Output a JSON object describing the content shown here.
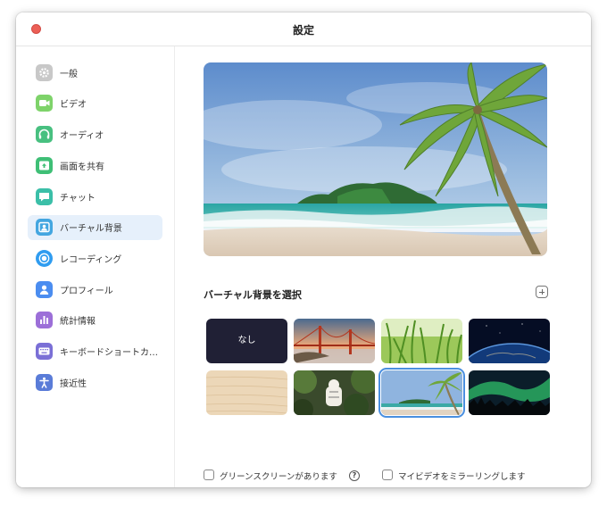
{
  "window": {
    "title": "設定"
  },
  "sidebar": {
    "items": [
      {
        "label": "一般",
        "icon": "gear-icon",
        "color": "#c8c8c8"
      },
      {
        "label": "ビデオ",
        "icon": "video-camera-icon",
        "color": "#7ed36a"
      },
      {
        "label": "オーディオ",
        "icon": "headphones-icon",
        "color": "#48c080"
      },
      {
        "label": "画面を共有",
        "icon": "share-screen-icon",
        "color": "#3fbf76"
      },
      {
        "label": "チャット",
        "icon": "chat-bubble-icon",
        "color": "#3bbfa8"
      },
      {
        "label": "バーチャル背景",
        "icon": "virtual-background-icon",
        "color": "#43a6e0"
      },
      {
        "label": "レコーディング",
        "icon": "record-icon",
        "color": "#2f9cf0"
      },
      {
        "label": "プロフィール",
        "icon": "person-icon",
        "color": "#4b8df0"
      },
      {
        "label": "統計情報",
        "icon": "bar-chart-icon",
        "color": "#9c6fd8"
      },
      {
        "label": "キーボードショートカ…",
        "icon": "keyboard-icon",
        "color": "#7a6fd6"
      },
      {
        "label": "接近性",
        "icon": "accessibility-icon",
        "color": "#5a7cd8"
      }
    ],
    "active_index": 5
  },
  "main": {
    "section_title": "バーチャル背景を選択",
    "thumbnails": [
      {
        "label": "なし",
        "kind": "none"
      },
      {
        "kind": "golden-gate-bridge"
      },
      {
        "kind": "grass"
      },
      {
        "kind": "earth-from-space"
      },
      {
        "kind": "wood"
      },
      {
        "kind": "white-tiger-jungle"
      },
      {
        "kind": "beach-palm",
        "selected": true
      },
      {
        "kind": "aurora"
      }
    ],
    "green_screen_label": "グリーンスクリーンがあります",
    "mirror_label": "マイビデオをミラーリングします",
    "help_glyph": "?"
  }
}
